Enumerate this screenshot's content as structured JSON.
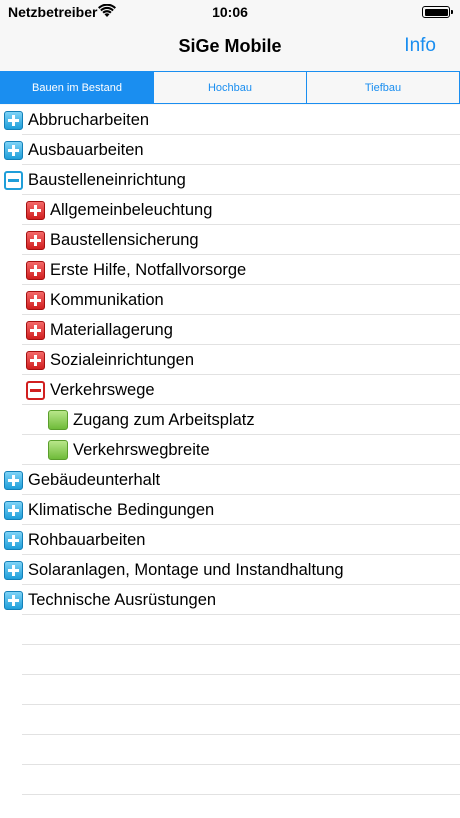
{
  "status_bar": {
    "carrier": "Netzbetreiber",
    "time": "10:06"
  },
  "nav": {
    "title": "SiGe Mobile",
    "info_label": "Info"
  },
  "tabs": [
    {
      "label": "Bauen im Bestand",
      "selected": true
    },
    {
      "label": "Hochbau",
      "selected": false
    },
    {
      "label": "Tiefbau",
      "selected": false
    }
  ],
  "tree": [
    {
      "label": "Abbrucharbeiten",
      "level": 0,
      "icon": "expand-plus-blue-icon"
    },
    {
      "label": "Ausbauarbeiten",
      "level": 0,
      "icon": "expand-plus-blue-icon"
    },
    {
      "label": "Baustelleneinrichtung",
      "level": 0,
      "icon": "collapse-minus-blue-icon"
    },
    {
      "label": "Allgemeinbeleuchtung",
      "level": 1,
      "icon": "expand-plus-red-icon"
    },
    {
      "label": "Baustellensicherung",
      "level": 1,
      "icon": "expand-plus-red-icon"
    },
    {
      "label": "Erste Hilfe, Notfallvorsorge",
      "level": 1,
      "icon": "expand-plus-red-icon"
    },
    {
      "label": "Kommunikation",
      "level": 1,
      "icon": "expand-plus-red-icon"
    },
    {
      "label": "Materiallagerung",
      "level": 1,
      "icon": "expand-plus-red-icon"
    },
    {
      "label": "Sozialeinrichtungen",
      "level": 1,
      "icon": "expand-plus-red-icon"
    },
    {
      "label": "Verkehrswege",
      "level": 1,
      "icon": "collapse-minus-red-icon"
    },
    {
      "label": "Zugang zum Arbeitsplatz",
      "level": 2,
      "icon": "leaf-green-icon"
    },
    {
      "label": "Verkehrswegbreite",
      "level": 2,
      "icon": "leaf-green-icon"
    },
    {
      "label": "Gebäudeunterhalt",
      "level": 0,
      "icon": "expand-plus-blue-icon"
    },
    {
      "label": "Klimatische Bedingungen",
      "level": 0,
      "icon": "expand-plus-blue-icon"
    },
    {
      "label": "Rohbauarbeiten",
      "level": 0,
      "icon": "expand-plus-blue-icon"
    },
    {
      "label": "Solaranlagen, Montage und Instandhaltung",
      "level": 0,
      "icon": "expand-plus-blue-icon"
    },
    {
      "label": "Technische Ausrüstungen",
      "level": 0,
      "icon": "expand-plus-blue-icon"
    }
  ],
  "colors": {
    "accent": "#1a8ef0",
    "bar_background": "#f7f7f7",
    "plus_blue": "#1f9ed9",
    "plus_red": "#d11f1f",
    "leaf_green": "#6fbb3a",
    "separator": "#e2e2e2"
  }
}
